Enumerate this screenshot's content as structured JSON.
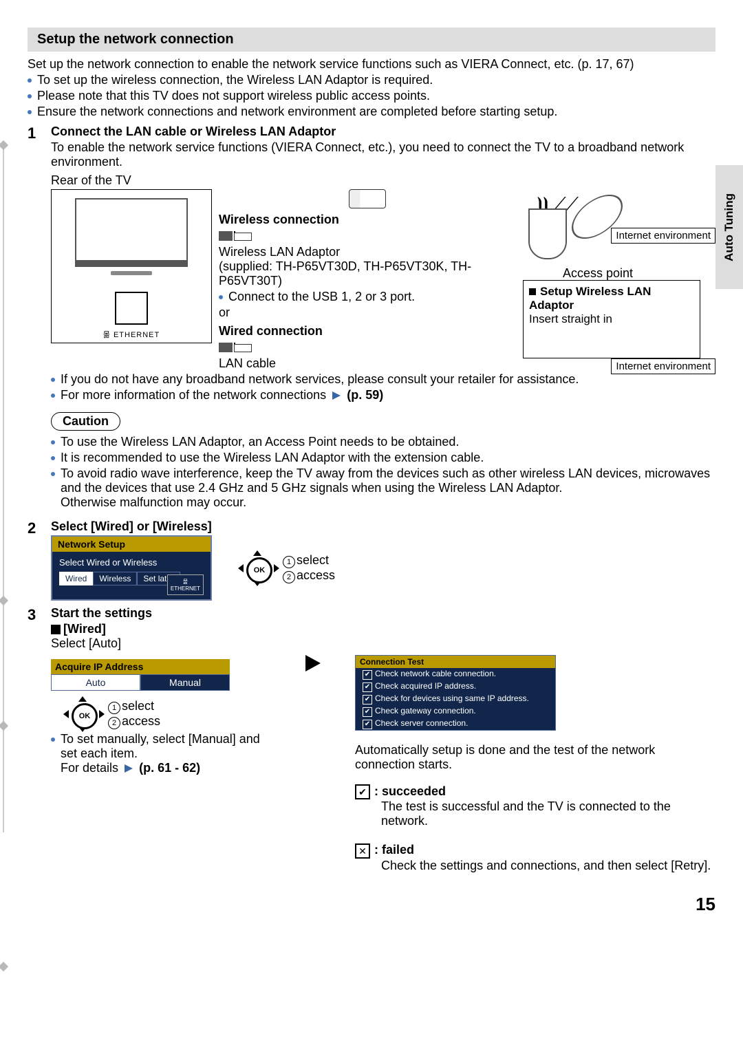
{
  "sideTab": "Auto Tuning",
  "sectionHeader": "Setup the network connection",
  "intro": "Set up the network connection to enable the network service functions such as VIERA Connect, etc. (p. 17, 67)",
  "introBullets": [
    "To set up the wireless connection, the Wireless LAN Adaptor is required.",
    "Please note that this TV does not support wireless public access points.",
    "Ensure the network connections and network environment are completed before starting setup."
  ],
  "step1": {
    "num": "1",
    "title": "Connect the LAN cable or Wireless LAN Adaptor",
    "desc": "To enable the network service functions (VIERA Connect, etc.), you need to connect the TV to a broadband network environment.",
    "rear": "Rear of the TV",
    "portLabel": "ETHERNET",
    "wirelessTitle": "Wireless connection",
    "wlanAdaptor": "Wireless LAN Adaptor",
    "supplied": "(supplied: TH-P65VT30D, TH-P65VT30K, TH-P65VT30T)",
    "connectUsb": "Connect to the USB 1, 2 or 3 port.",
    "or": "or",
    "wiredTitle": "Wired connection",
    "lanCable": "LAN cable",
    "accessPoint": "Access point",
    "setupWlanTitle": "Setup Wireless LAN Adaptor",
    "insert": "Insert straight in",
    "internet": "Internet environment",
    "finalBullets": [
      "If you do not have any broadband network services, please consult your retailer for assistance.",
      "For more information of the network connections"
    ],
    "pageRef1": "(p. 59)",
    "caution": "Caution",
    "cautionBullets": [
      "To use the Wireless LAN Adaptor, an Access Point needs to be obtained.",
      "It is recommended to use the Wireless LAN Adaptor with the extension cable.",
      "To avoid radio wave interference, keep the TV away from the devices such as other wireless LAN devices, microwaves and the devices that use 2.4 GHz and 5 GHz signals when using the Wireless LAN Adaptor."
    ],
    "otherwise": "Otherwise malfunction may occur."
  },
  "step2": {
    "num": "2",
    "title": "Select [Wired] or [Wireless]",
    "osdHeader": "Network Setup",
    "osdLine": "Select Wired or Wireless",
    "opts": {
      "wired": "Wired",
      "wireless": "Wireless",
      "later": "Set later"
    },
    "ethernet": "ETHERNET",
    "ok": "OK",
    "select": "select",
    "access": "access"
  },
  "step3": {
    "num": "3",
    "title": "Start the settings",
    "wired": "[Wired]",
    "selectAuto": "Select [Auto]",
    "ipHeader": "Acquire IP Address",
    "auto": "Auto",
    "manual": "Manual",
    "ok": "OK",
    "select": "select",
    "access": "access",
    "manualNote": "To set manually, select [Manual] and set each item.",
    "forDetails": "For details",
    "pageRef2": "(p. 61 - 62)",
    "connTest": "Connection Test",
    "checks": [
      "Check network cable connection.",
      "Check acquired IP address.",
      "Check for devices using same IP address.",
      "Check gateway connection.",
      "Check server connection."
    ],
    "autoText": "Automatically setup is done and the test of the network connection starts.",
    "succeeded": ": succeeded",
    "succeededText": "The test is successful and the TV is connected to the network.",
    "failed": ": failed",
    "failedText": "Check the settings and connections, and then select [Retry]."
  },
  "pageNum": "15"
}
